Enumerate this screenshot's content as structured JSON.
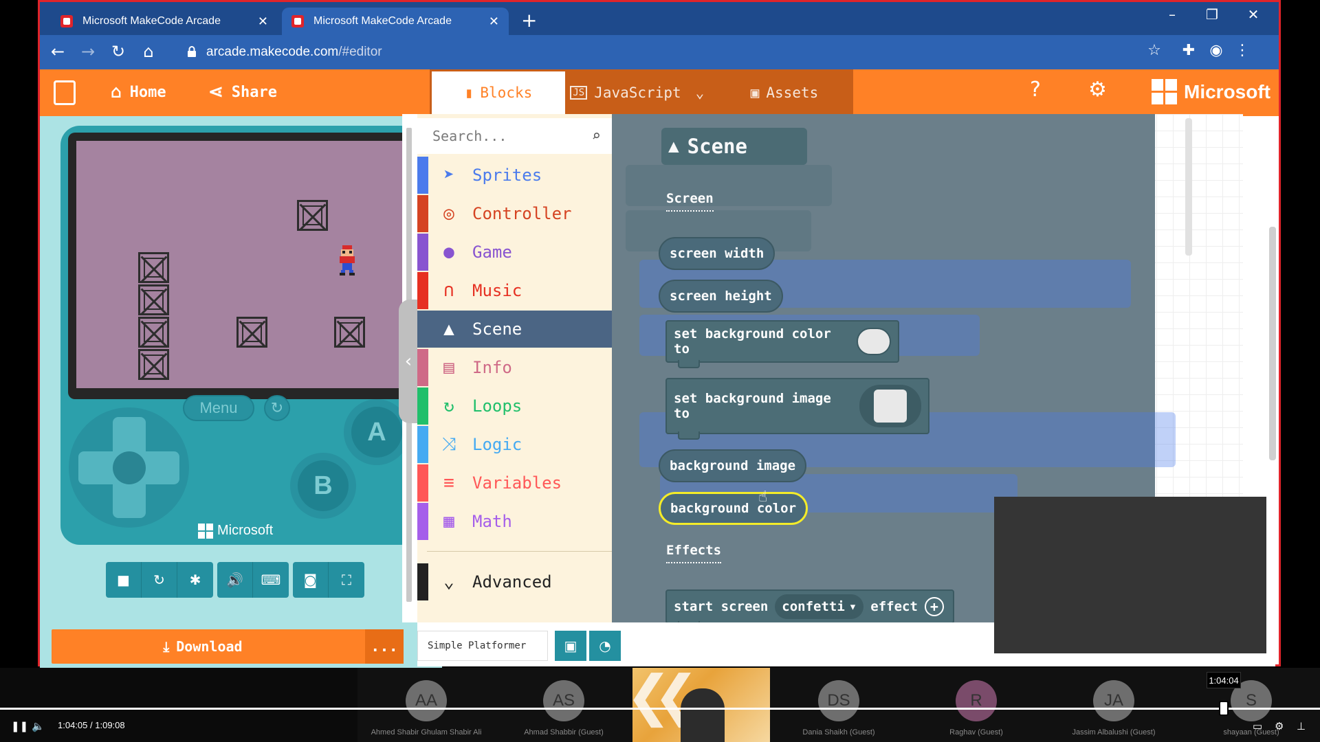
{
  "browser": {
    "tabs": [
      {
        "title": "Microsoft MakeCode Arcade"
      },
      {
        "title": "Microsoft MakeCode Arcade"
      }
    ],
    "url_host": "arcade.makecode.com",
    "url_path": "/#editor"
  },
  "header": {
    "home_label": "Home",
    "share_label": "Share",
    "tabs": [
      {
        "label": "Blocks"
      },
      {
        "label": "JavaScript"
      },
      {
        "label": "Assets"
      }
    ],
    "brand": "Microsoft"
  },
  "simulator": {
    "menu_label": "Menu",
    "btn_a": "A",
    "btn_b": "B",
    "console_brand": "Microsoft",
    "download_label": "Download",
    "more_label": "..."
  },
  "toolbox": {
    "search_placeholder": "Search...",
    "categories": [
      {
        "label": "Sprites",
        "color": "#4b7bec"
      },
      {
        "label": "Controller",
        "color": "#d54322"
      },
      {
        "label": "Game",
        "color": "#8854d0"
      },
      {
        "label": "Music",
        "color": "#e63022"
      },
      {
        "label": "Scene",
        "color": "#4b6584"
      },
      {
        "label": "Info",
        "color": "#cf6a87"
      },
      {
        "label": "Loops",
        "color": "#20bf6b"
      },
      {
        "label": "Logic",
        "color": "#45aaf2"
      },
      {
        "label": "Variables",
        "color": "#ff5757"
      },
      {
        "label": "Math",
        "color": "#a55eea"
      },
      {
        "label": "Advanced",
        "color": "#222222"
      }
    ],
    "selected": "Scene"
  },
  "project": {
    "name": "Simple Platformer"
  },
  "flyout": {
    "title": "Scene",
    "section_screen": "Screen",
    "section_effects": "Effects",
    "blocks": {
      "screen_width": "screen width",
      "screen_height": "screen height",
      "set_bg_color": "set background color to",
      "set_bg_image": "set background image to",
      "bg_image": "background image",
      "bg_color": "background color",
      "start_screen": "start screen",
      "effect_dropdown": "confetti",
      "effect": "effect"
    }
  },
  "meeting": {
    "participants": [
      {
        "initials": "AA",
        "name": "Ahmed Shabir Ghulam Shabir Ali"
      },
      {
        "initials": "AS",
        "name": "Ahmad Shabbir (Guest)"
      },
      {
        "initials": "DS",
        "name": "Dania Shaikh (Guest)"
      },
      {
        "initials": "R",
        "name": "Raghav (Guest)"
      },
      {
        "initials": "JA",
        "name": "Jassim Albalushi (Guest)"
      },
      {
        "initials": "S",
        "name": "shayaan (Guest)"
      }
    ]
  },
  "player": {
    "current": "1:04:05",
    "separator": "/",
    "duration": "1:09:08",
    "scrub_tooltip": "1:04:04",
    "progress_fraction": 0.927
  }
}
